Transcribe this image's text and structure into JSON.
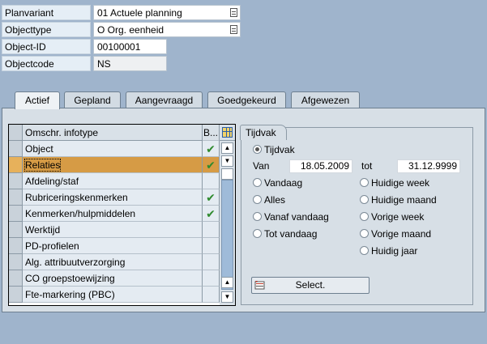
{
  "header": {
    "fields": [
      {
        "label": "Planvariant",
        "value": "01 Actuele planning"
      },
      {
        "label": "Objecttype",
        "value": "O Org. eenheid"
      },
      {
        "label": "Object-ID",
        "value": "00100001"
      },
      {
        "label": "Objectcode",
        "value": "NS"
      }
    ]
  },
  "tabs": [
    "Actief",
    "Gepland",
    "Aangevraagd",
    "Goedgekeurd",
    "Afgewezen"
  ],
  "active_tab": "Actief",
  "infotype_table": {
    "columns": [
      "Omschr. infotype",
      "B..."
    ],
    "rows": [
      {
        "name": "Object",
        "check": "✔"
      },
      {
        "name": "Relaties",
        "check": "✔",
        "selected": true
      },
      {
        "name": "Afdeling/staf",
        "check": ""
      },
      {
        "name": "Rubriceringskenmerken",
        "check": "✔"
      },
      {
        "name": "Kenmerken/hulpmiddelen",
        "check": "✔"
      },
      {
        "name": "Werktijd",
        "check": ""
      },
      {
        "name": "PD-profielen",
        "check": ""
      },
      {
        "name": "Alg. attribuutverzorging",
        "check": ""
      },
      {
        "name": "CO groepstoewijzing",
        "check": ""
      },
      {
        "name": "Fte-markering (PBC)",
        "check": ""
      }
    ]
  },
  "tijdvak": {
    "title": "Tijdvak",
    "tijdvak_label": "Tijdvak",
    "van_label": "Van",
    "van_value": "18.05.2009",
    "tot_label": "tot",
    "tot_value": "31.12.9999",
    "options_left": [
      "Vandaag",
      "Alles",
      "Vanaf vandaag",
      "Tot vandaag"
    ],
    "options_right": [
      "Huidige week",
      "Huidige maand",
      "Vorige week",
      "Vorige maand",
      "Huidig jaar"
    ],
    "select_button": "Select."
  },
  "colors": {
    "background": "#9fb4cc",
    "selected_row": "#d69b45",
    "check": "#2e8a2e"
  }
}
